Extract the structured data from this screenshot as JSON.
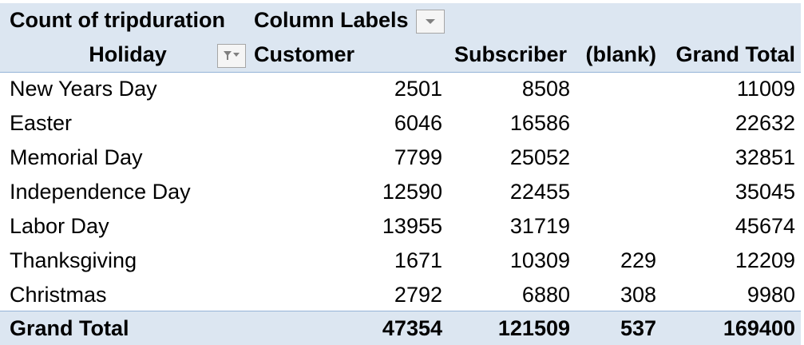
{
  "pivot": {
    "header": {
      "value_field": "Count of tripduration",
      "column_labels": "Column Labels",
      "row_field": "Holiday",
      "columns": [
        "Customer",
        "Subscriber",
        "(blank)",
        "Grand Total"
      ]
    },
    "rows": [
      {
        "label": "New Years Day",
        "values": [
          "2501",
          "8508",
          "",
          "11009"
        ]
      },
      {
        "label": "Easter",
        "values": [
          "6046",
          "16586",
          "",
          "22632"
        ]
      },
      {
        "label": "Memorial Day",
        "values": [
          "7799",
          "25052",
          "",
          "32851"
        ]
      },
      {
        "label": "Independence Day",
        "values": [
          "12590",
          "22455",
          "",
          "35045"
        ]
      },
      {
        "label": "Labor Day",
        "values": [
          "13955",
          "31719",
          "",
          "45674"
        ]
      },
      {
        "label": "Thanksgiving",
        "values": [
          "1671",
          "10309",
          "229",
          "12209"
        ]
      },
      {
        "label": "Christmas",
        "values": [
          "2792",
          "6880",
          "308",
          "9980"
        ]
      }
    ],
    "grand_total": {
      "label": "Grand Total",
      "values": [
        "47354",
        "121509",
        "537",
        "169400"
      ]
    },
    "icons": {
      "column_dropdown": "chevron-down-icon",
      "row_filter": "filter-dropdown-icon"
    },
    "colors": {
      "header_fill": "#dce6f1",
      "border": "#95b3d7"
    }
  }
}
